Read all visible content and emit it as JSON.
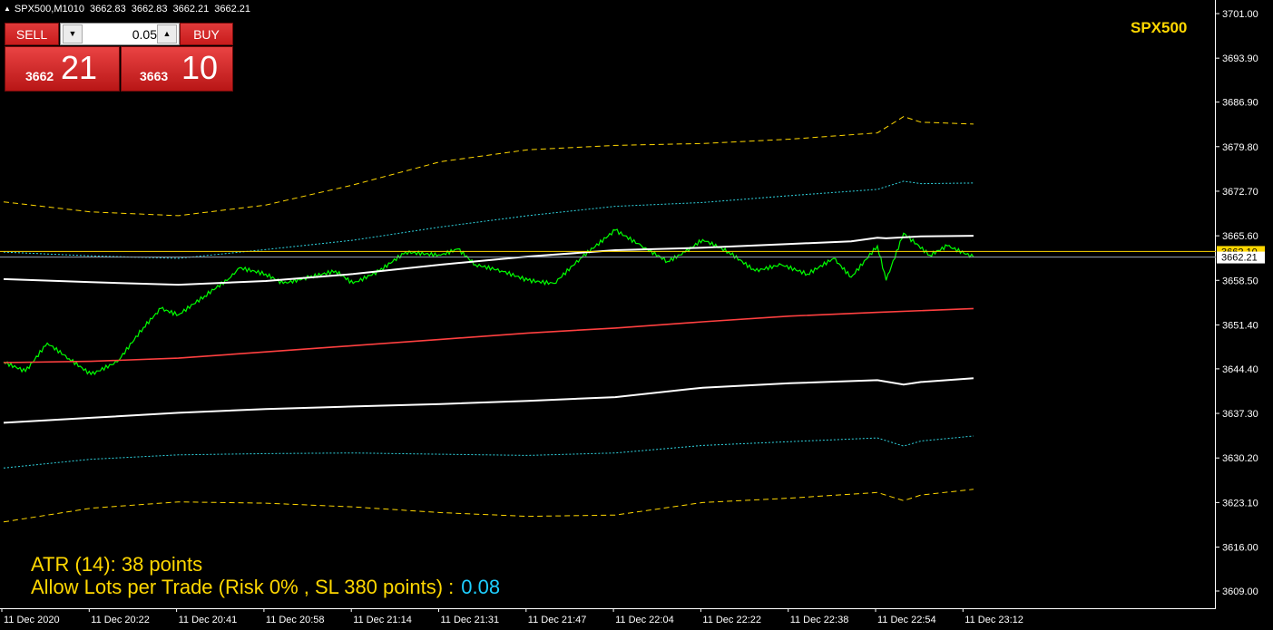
{
  "header": {
    "symbol_timeframe": "SPX500,M1010",
    "open": "3662.83",
    "high": "3662.83",
    "low": "3662.21",
    "close": "3662.21"
  },
  "trade_panel": {
    "sell_label": "SELL",
    "buy_label": "BUY",
    "lot_value": "0.05",
    "sell_price_main": "3662",
    "sell_price_frac": "21",
    "buy_price_main": "3663",
    "buy_price_frac": "10"
  },
  "brand_label": "SPX500",
  "info": {
    "atr_text": "ATR (14): 38 points",
    "lots_text": "Allow Lots per Trade (Risk 0% , SL 380 points) :",
    "lots_value": "0.08"
  },
  "price_markers": {
    "ask_label": "3662.10",
    "bid_label": "3662.21",
    "ask_value": 3663.1,
    "bid_value": 3662.21
  },
  "colors": {
    "price_line": "#00ff00",
    "middle_band": "#ff4040",
    "inner_band": "#ffffff",
    "mid_band": "#2fd4e0",
    "outer_band": "#ffd700",
    "brand": "#ffd700",
    "lots_value": "#1ecfff"
  },
  "chart_data": {
    "type": "line",
    "ylim": [
      3605.6,
      3703.8
    ],
    "y_ticks": [
      "3701.00",
      "3693.90",
      "3686.90",
      "3679.80",
      "3672.70",
      "3665.60",
      "3658.50",
      "3651.40",
      "3644.40",
      "3637.30",
      "3630.20",
      "3623.10",
      "3616.00",
      "3609.00"
    ],
    "y_tick_values": [
      3701.0,
      3693.9,
      3686.9,
      3679.8,
      3672.7,
      3665.6,
      3658.5,
      3651.4,
      3644.4,
      3637.3,
      3630.2,
      3623.1,
      3616.0,
      3609.0
    ],
    "x_ticks": [
      "11 Dec 2020",
      "11 Dec 20:22",
      "11 Dec 20:41",
      "11 Dec 20:58",
      "11 Dec 21:14",
      "11 Dec 21:31",
      "11 Dec 21:47",
      "11 Dec 22:04",
      "11 Dec 22:22",
      "11 Dec 22:38",
      "11 Dec 22:54",
      "11 Dec 23:12"
    ],
    "series": [
      {
        "role": "price",
        "x": [
          0,
          0.25,
          0.5,
          0.75,
          1,
          1.3,
          1.6,
          1.8,
          2,
          2.3,
          2.6,
          2.7,
          3,
          3.2,
          3.5,
          3.8,
          4,
          4.3,
          4.6,
          5,
          5.2,
          5.4,
          5.7,
          6,
          6.3,
          6.6,
          7,
          7.3,
          7.6,
          7.8,
          8,
          8.3,
          8.6,
          8.9,
          9.2,
          9.5,
          9.7,
          10,
          10.1,
          10.3,
          10.6,
          10.8,
          11.1
        ],
        "y": [
          3645.5,
          3644.0,
          3648.5,
          3646.0,
          3643.5,
          3645.5,
          3651.0,
          3654.0,
          3653.0,
          3656.0,
          3659.0,
          3660.5,
          3659.5,
          3658.0,
          3659.0,
          3660.0,
          3658.0,
          3660.0,
          3663.0,
          3662.5,
          3663.5,
          3661.0,
          3660.0,
          3658.5,
          3658.0,
          3662.0,
          3666.5,
          3664.0,
          3661.5,
          3663.0,
          3665.0,
          3663.0,
          3660.0,
          3661.0,
          3659.5,
          3662.0,
          3659.0,
          3664.0,
          3658.5,
          3666.0,
          3662.5,
          3664.0,
          3662.21
        ]
      },
      {
        "role": "inner_upper",
        "x": [
          0,
          1,
          2,
          3,
          4,
          5,
          6,
          7,
          8,
          9,
          9.7,
          10,
          10.1,
          10.5,
          11.1
        ],
        "y": [
          3658.7,
          3658.2,
          3657.8,
          3658.4,
          3659.5,
          3661.0,
          3662.3,
          3663.3,
          3663.7,
          3664.3,
          3664.7,
          3665.3,
          3665.2,
          3665.5,
          3665.6
        ]
      },
      {
        "role": "middle",
        "x": [
          0,
          1,
          2,
          3,
          4,
          5,
          6,
          7,
          8,
          9,
          10,
          11.1
        ],
        "y": [
          3645.4,
          3645.6,
          3646.1,
          3647.1,
          3648.1,
          3649.1,
          3650.1,
          3650.9,
          3651.9,
          3652.8,
          3653.4,
          3654.0
        ]
      },
      {
        "role": "inner_lower",
        "x": [
          0,
          1,
          2,
          3,
          4,
          5,
          6,
          7,
          8,
          9,
          10,
          10.3,
          10.5,
          11.1
        ],
        "y": [
          3635.8,
          3636.6,
          3637.4,
          3638.0,
          3638.4,
          3638.8,
          3639.3,
          3639.9,
          3641.4,
          3642.1,
          3642.6,
          3641.9,
          3642.3,
          3642.9
        ]
      },
      {
        "role": "mid_upper",
        "x": [
          0,
          1,
          2,
          3,
          4,
          5,
          6,
          7,
          8,
          9,
          10,
          10.3,
          10.5,
          11.1
        ],
        "y": [
          3663.0,
          3662.4,
          3662.0,
          3663.4,
          3664.9,
          3667.0,
          3668.8,
          3670.3,
          3670.9,
          3672.0,
          3673.0,
          3674.3,
          3673.9,
          3674.0
        ]
      },
      {
        "role": "mid_lower",
        "x": [
          0,
          1,
          2,
          3,
          4,
          5,
          6,
          7,
          8,
          9,
          10,
          10.3,
          10.5,
          11.1
        ],
        "y": [
          3628.6,
          3630.0,
          3630.7,
          3630.9,
          3631.0,
          3630.8,
          3630.6,
          3631.0,
          3632.2,
          3632.8,
          3633.4,
          3632.1,
          3632.9,
          3633.7
        ]
      },
      {
        "role": "outer_upper",
        "x": [
          0,
          1,
          2,
          3,
          4,
          5,
          6,
          7,
          8,
          9,
          10,
          10.3,
          10.5,
          11.1
        ],
        "y": [
          3671.0,
          3669.4,
          3668.8,
          3670.5,
          3673.7,
          3677.4,
          3679.3,
          3680.0,
          3680.3,
          3681.0,
          3682.0,
          3684.6,
          3683.7,
          3683.4
        ]
      },
      {
        "role": "outer_lower",
        "x": [
          0,
          1,
          2,
          3,
          4,
          5,
          6,
          7,
          8,
          9,
          10,
          10.3,
          10.5,
          11.1
        ],
        "y": [
          3620.0,
          3622.2,
          3623.2,
          3623.0,
          3622.4,
          3621.5,
          3620.9,
          3621.1,
          3623.1,
          3623.8,
          3624.7,
          3623.4,
          3624.3,
          3625.2
        ]
      }
    ]
  }
}
